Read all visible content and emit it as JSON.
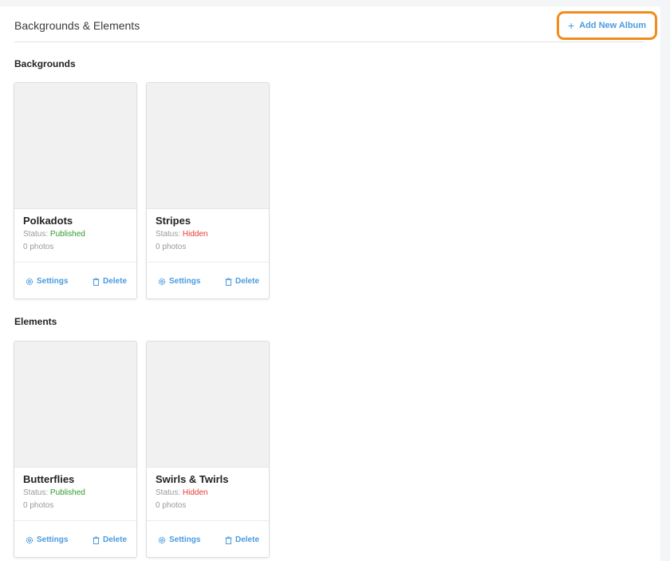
{
  "header": {
    "title": "Backgrounds & Elements",
    "add_album_label": "Add New Album",
    "add_icon": "+"
  },
  "sections": [
    {
      "title": "Backgrounds",
      "albums": [
        {
          "name": "Polkadots",
          "status_prefix": "Status:",
          "status": "Published",
          "photos": "0 photos",
          "settings_label": "Settings",
          "delete_label": "Delete"
        },
        {
          "name": "Stripes",
          "status_prefix": "Status:",
          "status": "Hidden",
          "photos": "0 photos",
          "settings_label": "Settings",
          "delete_label": "Delete"
        }
      ]
    },
    {
      "title": "Elements",
      "albums": [
        {
          "name": "Butterflies",
          "status_prefix": "Status:",
          "status": "Published",
          "photos": "0 photos",
          "settings_label": "Settings",
          "delete_label": "Delete"
        },
        {
          "name": "Swirls & Twirls",
          "status_prefix": "Status:",
          "status": "Hidden",
          "photos": "0 photos",
          "settings_label": "Settings",
          "delete_label": "Delete"
        }
      ]
    }
  ],
  "colors": {
    "accent": "#4a9be0",
    "highlight": "#f28c1b",
    "published": "#2e9a2e",
    "hidden": "#e53935"
  }
}
